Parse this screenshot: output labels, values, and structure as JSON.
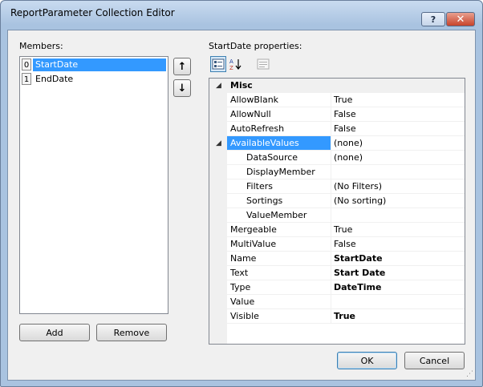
{
  "window": {
    "title": "ReportParameter Collection Editor",
    "help_label": "?",
    "close_label": "✕"
  },
  "members": {
    "label": "Members:",
    "items": [
      {
        "index": "0",
        "name": "StartDate",
        "selected": true
      },
      {
        "index": "1",
        "name": "EndDate",
        "selected": false
      }
    ],
    "add_label": "Add",
    "remove_label": "Remove",
    "up_icon": "↑",
    "down_icon": "↓"
  },
  "properties": {
    "label": "StartDate properties:",
    "category": "Misc",
    "rows": [
      {
        "name": "AllowBlank",
        "value": "True"
      },
      {
        "name": "AllowNull",
        "value": "False"
      },
      {
        "name": "AutoRefresh",
        "value": "False"
      },
      {
        "name": "AvailableValues",
        "value": "(none)"
      },
      {
        "name": "DataSource",
        "value": "(none)"
      },
      {
        "name": "DisplayMember",
        "value": ""
      },
      {
        "name": "Filters",
        "value": "(No Filters)"
      },
      {
        "name": "Sortings",
        "value": "(No sorting)"
      },
      {
        "name": "ValueMember",
        "value": ""
      },
      {
        "name": "Mergeable",
        "value": "True"
      },
      {
        "name": "MultiValue",
        "value": "False"
      },
      {
        "name": "Name",
        "value": "StartDate"
      },
      {
        "name": "Text",
        "value": "Start Date"
      },
      {
        "name": "Type",
        "value": "DateTime"
      },
      {
        "name": "Value",
        "value": ""
      },
      {
        "name": "Visible",
        "value": "True"
      }
    ]
  },
  "buttons": {
    "ok": "OK",
    "cancel": "Cancel"
  },
  "colors": {
    "selection": "#3399ff",
    "frame": "#a9c3e0"
  }
}
